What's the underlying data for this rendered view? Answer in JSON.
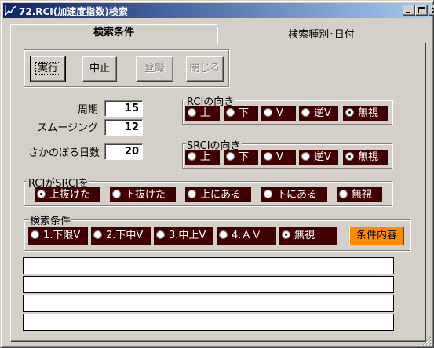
{
  "window": {
    "title": "72.RCI(加速度指数)検索"
  },
  "tabs": [
    {
      "label": "検索条件"
    },
    {
      "label": "検索種別･日付"
    }
  ],
  "buttons": {
    "run": "実行",
    "stop": "中止",
    "register": "登録",
    "close": "閉じる"
  },
  "params": {
    "period_label": "周期",
    "period_value": "15",
    "smoothing_label": "スムージング",
    "smoothing_value": "12",
    "lookback_label": "さかのぼる日数",
    "lookback_value": "20"
  },
  "rci_direction": {
    "title": "RCIの向き",
    "options": [
      "上",
      "下",
      "V",
      "逆V",
      "無視"
    ],
    "selected": "無視"
  },
  "srci_direction": {
    "title": "SRCIの向き",
    "options": [
      "上",
      "下",
      "V",
      "逆V",
      "無視"
    ],
    "selected": "無視"
  },
  "rci_vs_srci": {
    "title": "RCIがSRCIを",
    "options": [
      "上抜けた",
      "下抜けた",
      "上にある",
      "下にある",
      "無視"
    ],
    "selected": "上抜けた"
  },
  "search_condition": {
    "title": "検索条件",
    "options": [
      "1.下限V",
      "2.下中V",
      "3.中上V",
      "4.ＡＶ",
      "無視"
    ],
    "selected": "無視",
    "detail_button": "条件内容"
  },
  "colors": {
    "radio_bg": "#400000",
    "title_gradient_start": "#0a246a",
    "title_gradient_end": "#a6caf0",
    "detail_button": "#ff8c00"
  }
}
